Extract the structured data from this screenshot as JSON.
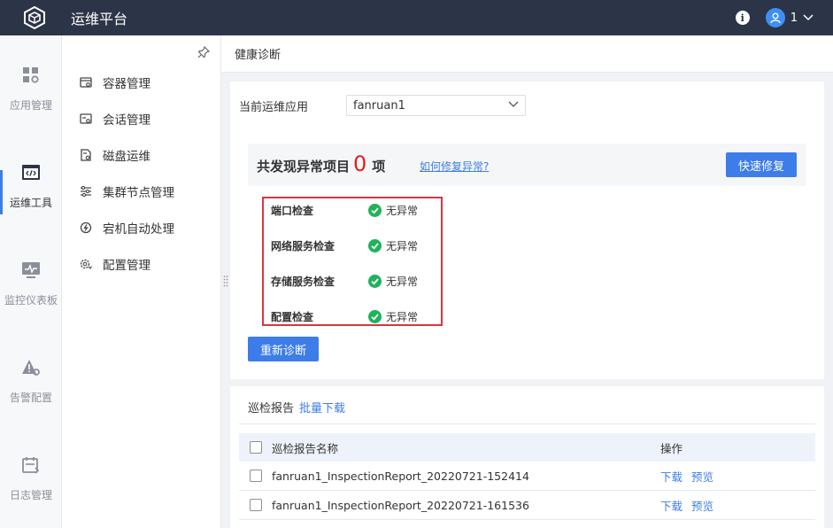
{
  "topbar": {
    "title": "运维平台",
    "user": "1"
  },
  "rail": [
    {
      "label": "应用管理",
      "icon": "app-grid-icon",
      "active": false
    },
    {
      "label": "运维工具",
      "icon": "code-window-icon",
      "active": true
    },
    {
      "label": "监控仪表板",
      "icon": "monitor-pulse-icon",
      "active": false
    },
    {
      "label": "告警配置",
      "icon": "alert-gear-icon",
      "active": false
    },
    {
      "label": "日志管理",
      "icon": "calendar-log-icon",
      "active": false
    }
  ],
  "submenu": [
    {
      "label": "容器管理",
      "icon": "container-icon"
    },
    {
      "label": "会话管理",
      "icon": "session-icon"
    },
    {
      "label": "磁盘运维",
      "icon": "disk-icon"
    },
    {
      "label": "集群节点管理",
      "icon": "sliders-icon"
    },
    {
      "label": "宕机自动处理",
      "icon": "auto-recover-icon"
    },
    {
      "label": "配置管理",
      "icon": "config-gear-icon"
    }
  ],
  "breadcrumb": "健康诊断",
  "diagnosis": {
    "app_label": "当前运维应用",
    "app_value": "fanruan1",
    "summary_prefix": "共发现异常项目",
    "summary_count": "0",
    "summary_suffix": "项",
    "help_link": "如何修复异常?",
    "quick_fix": "快速修复",
    "checks": [
      {
        "name": "端口检查",
        "status": "无异常"
      },
      {
        "name": "网络服务检查",
        "status": "无异常"
      },
      {
        "name": "存储服务检查",
        "status": "无异常"
      },
      {
        "name": "配置检查",
        "status": "无异常"
      }
    ],
    "rediagnose": "重新诊断"
  },
  "reports": {
    "title": "巡检报告",
    "batch_download": "批量下载",
    "columns": {
      "name": "巡检报告名称",
      "ops": "操作"
    },
    "rows": [
      {
        "name": "fanruan1_InspectionReport_20220721-152414",
        "download": "下载",
        "preview": "预览"
      },
      {
        "name": "fanruan1_InspectionReport_20220721-161536",
        "download": "下载",
        "preview": "预览"
      }
    ]
  },
  "colors": {
    "topbar": "#2c3447",
    "accent": "#3d7de9",
    "danger": "#e21e1e",
    "success": "#1fb35a"
  }
}
